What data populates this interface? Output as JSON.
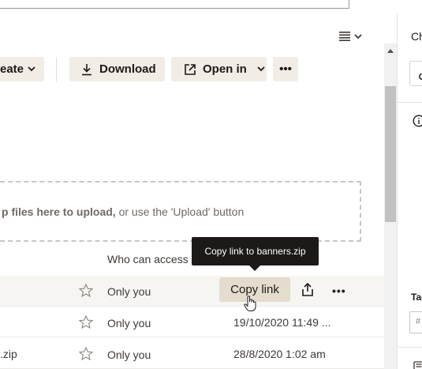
{
  "toolbar": {
    "create_label": "eate",
    "download_label": "Download",
    "open_in_label": "Open in",
    "more_label": "•••"
  },
  "upload_zone": {
    "bold_text": "p files here to upload,",
    "rest_text": " or use the 'Upload' button"
  },
  "table": {
    "who_can_access_header": "Who can access",
    "rows": [
      {
        "name": "",
        "access": "Only you",
        "modified": ""
      },
      {
        "name": "",
        "access": "Only you",
        "modified": "19/10/2020 11:49 ..."
      },
      {
        "name": ".zip",
        "access": "Only you",
        "modified": "28/8/2020 1:02 am"
      }
    ]
  },
  "row_actions": {
    "copy_link_label": "Copy link",
    "more_label": "•••"
  },
  "tooltip": {
    "text": "Copy link to banners.zip"
  },
  "right_panel": {
    "title": "Ch",
    "tags_label": "Tag",
    "tag_input_placeholder": "# "
  },
  "icons": {
    "view": "list-view-icon",
    "download": "download-icon",
    "open_in": "open-in-icon",
    "star": "star-outline-icon",
    "share": "share-upload-icon",
    "info": "info-icon",
    "link": "link-icon"
  },
  "colors": {
    "button_bg": "#f1ece5",
    "copy_link_bg": "#e4dccc",
    "tooltip_bg": "#1e1919",
    "highlight_row": "#f7f5f2",
    "text": "#1e1919"
  }
}
